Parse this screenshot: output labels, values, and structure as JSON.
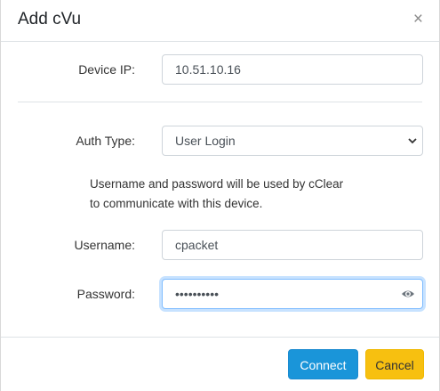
{
  "modal": {
    "title": "Add cVu",
    "close_glyph": "×"
  },
  "form": {
    "device_ip": {
      "label": "Device IP:",
      "value": "10.51.10.16"
    },
    "auth_type": {
      "label": "Auth Type:",
      "value": "User Login"
    },
    "help_line1": "Username and password will be used by cClear",
    "help_line2": "to communicate with this device.",
    "username": {
      "label": "Username:",
      "value": "cpacket"
    },
    "password": {
      "label": "Password:",
      "value": "••••••••••"
    }
  },
  "footer": {
    "connect_label": "Connect",
    "cancel_label": "Cancel"
  },
  "colors": {
    "connect": "#1a95d9",
    "cancel": "#f7c010"
  }
}
